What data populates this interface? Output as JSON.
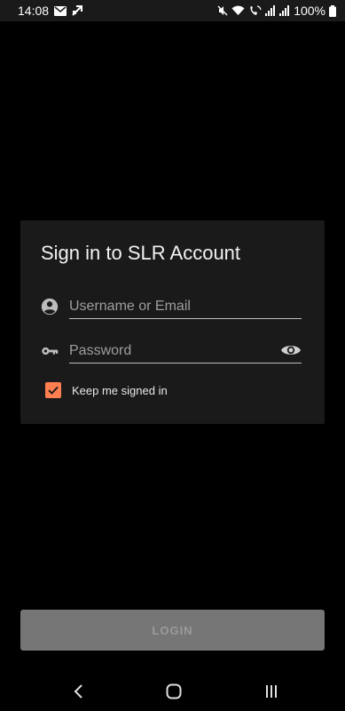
{
  "status_bar": {
    "time": "14:08",
    "battery": "100%",
    "icons": [
      "mail-icon",
      "notification-icon",
      "mute-icon",
      "wifi-icon",
      "wifi-calling-icon",
      "signal-icon",
      "signal-icon",
      "battery-icon"
    ]
  },
  "login_card": {
    "title": "Sign in to SLR Account",
    "username": {
      "placeholder": "Username or Email",
      "value": "",
      "icon": "account-circle-icon"
    },
    "password": {
      "placeholder": "Password",
      "value": "",
      "icon": "key-icon",
      "toggle_icon": "eye-icon"
    },
    "remember": {
      "label": "Keep me signed in",
      "checked": true
    }
  },
  "login_button": {
    "label": "LOGIN"
  },
  "nav_bar": {
    "icons": [
      "back-icon",
      "home-icon",
      "recent-apps-icon"
    ]
  },
  "colors": {
    "background": "#000000",
    "card": "#1a1a1a",
    "accent": "#ff7f50",
    "button_disabled": "#767676"
  }
}
